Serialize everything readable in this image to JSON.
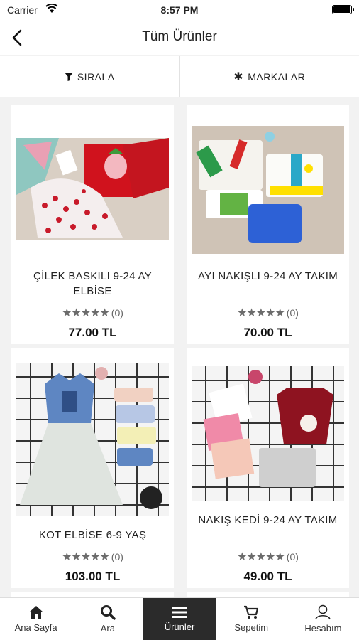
{
  "status_bar": {
    "carrier": "Carrier",
    "time": "8:57 PM"
  },
  "nav": {
    "title": "Tüm Ürünler"
  },
  "filters": {
    "sort_label": "SIRALA",
    "brands_label": "MARKALAR"
  },
  "products": [
    {
      "name": "ÇİLEK BASKILI 9-24 AY ELBİSE",
      "rating_count": "(0)",
      "price": "77.00 TL"
    },
    {
      "name": "AYI NAKIŞLI 9-24 AY TAKIM",
      "rating_count": "(0)",
      "price": "70.00 TL"
    },
    {
      "name": "KOT ELBİSE 6-9 YAŞ",
      "rating_count": "(0)",
      "price": "103.00 TL"
    },
    {
      "name": "NAKIŞ KEDİ 9-24 AY TAKIM",
      "rating_count": "(0)",
      "price": "49.00 TL"
    }
  ],
  "stars": "★★★★★",
  "tabs": {
    "home": "Ana Sayfa",
    "search": "Ara",
    "products": "Ürünler",
    "cart": "Sepetim",
    "account": "Hesabım"
  },
  "active_tab": "products",
  "colors": {
    "active_tab_bg": "#2b2b2b",
    "background": "#f2f2f2"
  }
}
